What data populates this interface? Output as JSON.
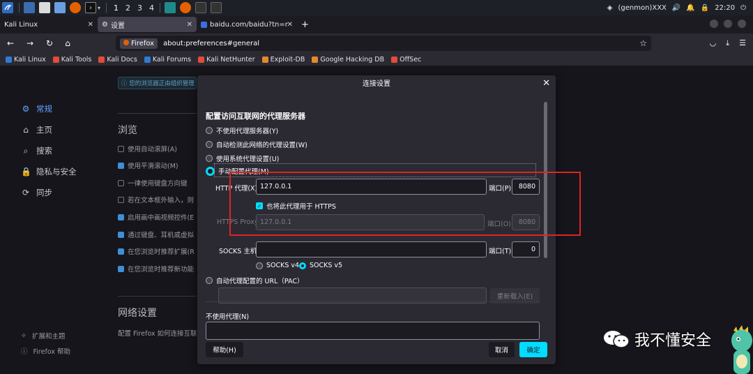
{
  "taskbar": {
    "workspaces": [
      "1",
      "2",
      "3",
      "4"
    ],
    "user": "(genmon)XXX",
    "clock": "22:20"
  },
  "tabs": [
    {
      "label": "Kali Linux"
    },
    {
      "label": "设置"
    },
    {
      "label": "baidu.com/baidu?tn=mon"
    }
  ],
  "urlbar": {
    "identity": "Firefox",
    "url": "about:preferences#general"
  },
  "bookmarks": [
    {
      "label": "Kali Linux",
      "color": "#2f7bd6"
    },
    {
      "label": "Kali Tools",
      "color": "#e34b3b"
    },
    {
      "label": "Kali Docs",
      "color": "#e34b3b"
    },
    {
      "label": "Kali Forums",
      "color": "#2f7bd6"
    },
    {
      "label": "Kali NetHunter",
      "color": "#e34b3b"
    },
    {
      "label": "Exploit-DB",
      "color": "#e38b2b"
    },
    {
      "label": "Google Hacking DB",
      "color": "#e38b2b"
    },
    {
      "label": "OffSec",
      "color": "#e34b3b"
    }
  ],
  "settings_page": {
    "notice": "您的浏览器正由组织管理",
    "sidebar": [
      "常规",
      "主页",
      "搜索",
      "隐私与安全",
      "同步"
    ],
    "sidebar_footer": [
      "扩展和主题",
      "Firefox 帮助"
    ],
    "browse_heading": "浏览",
    "browse_options": [
      {
        "label": "使用自动滚屏(A)",
        "checked": false
      },
      {
        "label": "使用平滑滚动(M)",
        "checked": true
      },
      {
        "label": "一律使用键盘方向键",
        "checked": false
      },
      {
        "label": "若在文本框外输入，则",
        "checked": false
      },
      {
        "label": "启用画中画视频控件(E",
        "checked": true
      },
      {
        "label": "通过键盘、耳机或虚拟",
        "checked": true
      },
      {
        "label": "在您浏览时推荐扩展(R",
        "checked": true
      },
      {
        "label": "在您浏览时推荐新功能",
        "checked": true
      }
    ],
    "network_heading": "网络设置",
    "network_desc": "配置 Firefox 如何连接互联"
  },
  "dialog": {
    "title": "连接设置",
    "section_heading": "配置访问互联网的代理服务器",
    "radios": [
      {
        "label": "不使用代理服务器(Y)",
        "selected": false
      },
      {
        "label": "自动检测此网络的代理设置(W)",
        "selected": false
      },
      {
        "label": "使用系统代理设置(U)",
        "selected": false
      },
      {
        "label": "手动配置代理(M)",
        "selected": true
      }
    ],
    "http_label": "HTTP 代理(X)",
    "http_value": "127.0.0.1",
    "http_port_label": "端口(P)",
    "http_port": "8080",
    "also_https_label": "也将此代理用于 HTTPS",
    "https_label": "HTTPS Proxy",
    "https_value": "127.0.0.1",
    "https_port_label": "端口(O)",
    "https_port": "8080",
    "socks_label": "SOCKS 主机",
    "socks_value": "",
    "socks_port_label": "端口(T)",
    "socks_port": "0",
    "socks_v4": "SOCKS v4",
    "socks_v5": "SOCKS v5",
    "pac_label": "自动代理配置的 URL（PAC）",
    "reload_label": "重新载入(E)",
    "no_proxy_label": "不使用代理(N)",
    "help_label": "帮助(H)",
    "cancel_label": "取消",
    "ok_label": "确定"
  },
  "watermark": {
    "text": "我不懂安全"
  },
  "colors": {
    "accent": "#00ddff",
    "highlight": "#e02323"
  }
}
